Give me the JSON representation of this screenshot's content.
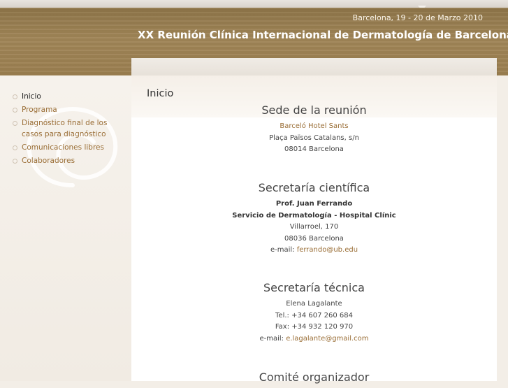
{
  "header": {
    "date": "Barcelona, 19 - 20 de Marzo 2010",
    "title": "XX Reunión Clínica Internacional de Dermatología de Barcelona"
  },
  "nav": {
    "items": [
      {
        "label": "Inicio",
        "active": true
      },
      {
        "label": "Programa",
        "active": false
      },
      {
        "label": "Diagnóstico final de los casos para diagnóstico",
        "active": false
      },
      {
        "label": "Comunicaciones libres",
        "active": false
      },
      {
        "label": "Colaboradores",
        "active": false
      }
    ]
  },
  "page": {
    "title": "Inicio"
  },
  "sede": {
    "heading": "Sede de la reunión",
    "hotel": "Barceló Hotel Sants",
    "address1": "Plaça Països Catalans, s/n",
    "address2": "08014 Barcelona"
  },
  "cientifica": {
    "heading": "Secretaría científica",
    "name": "Prof. Juan Ferrando",
    "service": "Servicio de Dermatología - Hospital Clínic",
    "street": "Villarroel, 170",
    "city": "08036 Barcelona",
    "email_label": "e-mail: ",
    "email": "ferrando@ub.edu"
  },
  "tecnica": {
    "heading": "Secretaría técnica",
    "name": "Elena Lagalante",
    "tel": "Tel.: +34 607 260 684",
    "fax": "Fax: +34 932 120 970",
    "email_label": "e-mail: ",
    "email": "e.lagalante@gmail.com"
  },
  "comite": {
    "heading": "Comité organizador"
  },
  "colors": {
    "header_bg": "#9b7f50",
    "link": "#9a6e36",
    "content_bg": "#ffffff"
  }
}
